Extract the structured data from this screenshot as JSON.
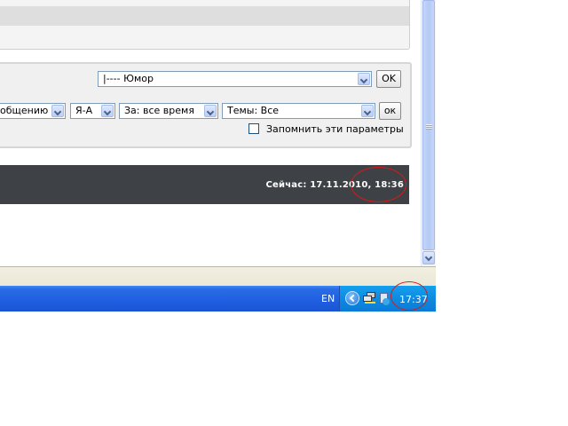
{
  "forum_filter": {
    "forum_select": "|---- Юмор",
    "forum_ok": "OK",
    "sort_by_select": "общению",
    "order_select": "Я-А",
    "period_select": "За: все время",
    "topics_select": "Темы: Все",
    "filter_ok": "ок",
    "remember_label": "Запомнить эти параметры"
  },
  "info_bar": {
    "now_text": "Сейчас: 17.11.2010, 18:36"
  },
  "taskbar": {
    "language": "EN",
    "clock": "17:37"
  },
  "annotation_color": "#d81a1a"
}
